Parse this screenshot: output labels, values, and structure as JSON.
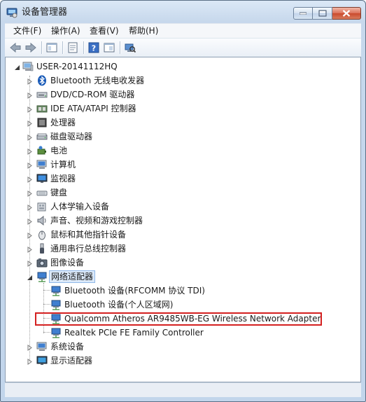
{
  "window": {
    "title": "设备管理器",
    "title_icon": "device-manager-icon",
    "controls": [
      "minimize-icon",
      "maximize-icon",
      "close-icon"
    ]
  },
  "menubar": {
    "items": [
      {
        "label": "文件(F)"
      },
      {
        "label": "操作(A)"
      },
      {
        "label": "查看(V)"
      },
      {
        "label": "帮助(H)"
      }
    ]
  },
  "toolbar": {
    "buttons": [
      "back-arrow-icon",
      "forward-arrow-icon",
      "show-hide-tree-icon",
      "properties-icon",
      "help-icon",
      "console-tree-icon",
      "scan-hardware-icon"
    ]
  },
  "tree": {
    "root": {
      "label": "USER-20141112HQ",
      "icon": "computer-icon"
    },
    "categories": [
      {
        "label": "Bluetooth 无线电收发器",
        "icon": "bluetooth-icon"
      },
      {
        "label": "DVD/CD-ROM 驱动器",
        "icon": "dvd-drive-icon"
      },
      {
        "label": "IDE ATA/ATAPI 控制器",
        "icon": "ide-controller-icon"
      },
      {
        "label": "处理器",
        "icon": "processor-icon"
      },
      {
        "label": "磁盘驱动器",
        "icon": "disk-drive-icon"
      },
      {
        "label": "电池",
        "icon": "battery-icon"
      },
      {
        "label": "计算机",
        "icon": "computer-icon"
      },
      {
        "label": "监视器",
        "icon": "monitor-icon"
      },
      {
        "label": "键盘",
        "icon": "keyboard-icon"
      },
      {
        "label": "人体学输入设备",
        "icon": "hid-icon"
      },
      {
        "label": "声音、视频和游戏控制器",
        "icon": "speaker-icon"
      },
      {
        "label": "鼠标和其他指针设备",
        "icon": "mouse-icon"
      },
      {
        "label": "通用串行总线控制器",
        "icon": "usb-icon"
      },
      {
        "label": "图像设备",
        "icon": "camera-icon"
      },
      {
        "label": "网络适配器",
        "icon": "network-adapter-icon",
        "expanded": true,
        "children": [
          {
            "label": "Bluetooth 设备(RFCOMM 协议 TDI)"
          },
          {
            "label": "Bluetooth 设备(个人区域网)"
          },
          {
            "label": "Qualcomm Atheros AR9485WB-EG Wireless Network Adapter",
            "highlighted": true
          },
          {
            "label": "Realtek PCIe FE Family Controller"
          }
        ]
      },
      {
        "label": "系统设备",
        "icon": "system-device-icon"
      },
      {
        "label": "显示适配器",
        "icon": "display-adapter-icon"
      }
    ]
  },
  "colors": {
    "highlight_border": "#d42020",
    "selection_bg": "#dbe9f9"
  }
}
